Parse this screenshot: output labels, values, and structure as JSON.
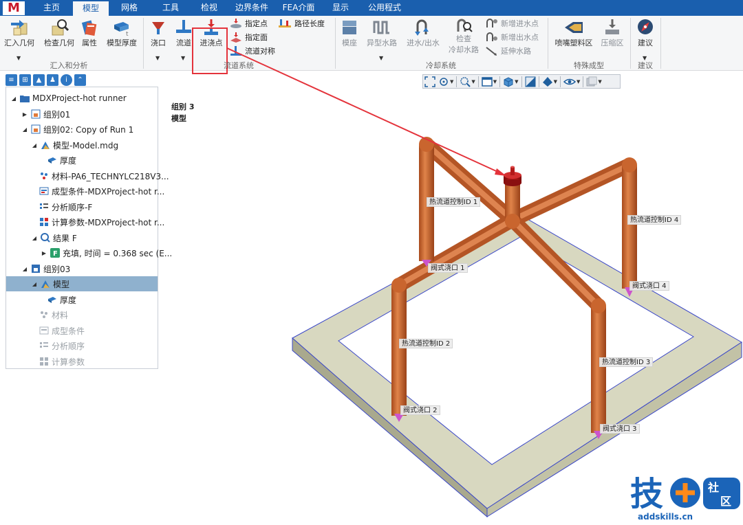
{
  "app": {
    "logo": "M"
  },
  "menu": {
    "tabs": [
      "主页",
      "模型",
      "网格",
      "工具",
      "检视",
      "边界条件",
      "FEA介面",
      "显示",
      "公用程式"
    ],
    "active": "模型"
  },
  "ribbon": {
    "import": {
      "import_geometry": "汇入几何",
      "check_geometry": "检查几何",
      "properties": "属性",
      "model_thickness": "模型厚度",
      "group_label": "汇入和分析"
    },
    "runner": {
      "gate": "浇口",
      "runner": "流道",
      "injection_point": "进浇点",
      "specify_point": "指定点",
      "specify_face": "指定面",
      "runner_symmetry": "流道对称",
      "path_length": "路径长度",
      "group_label": "流道系统"
    },
    "cooling": {
      "mold_base": "模座",
      "special_channel": "异型水路",
      "inlet_outlet": "进水/出水",
      "check_cooling_1": "检查",
      "check_cooling_2": "冷却水路",
      "add_inlet": "新增进水点",
      "add_outlet": "新增出水点",
      "extend_channel": "延伸水路",
      "group_label": "冷却系统"
    },
    "special": {
      "nozzle": "喷嘴塑料区",
      "compress": "压缩区",
      "group_label": "特殊成型"
    },
    "advice": {
      "advice": "建议",
      "group_label": "建议"
    }
  },
  "tree": {
    "project": "MDXProject-hot runner",
    "group01": "组别01",
    "group02": "组别02: Copy of Run 1",
    "model_mdg": "模型-Model.mdg",
    "thickness_1": "厚度",
    "material": "材料-PA6_TECHNYLC218V3...",
    "process": "成型条件-MDXProject-hot r...",
    "sequence": "分析顺序-F",
    "params": "计算参数-MDXProject-hot r...",
    "results": "结果  F",
    "filling": "充填, 时间 = 0.368 sec (E...",
    "group03": "组别03",
    "model": "模型",
    "thickness_2": "厚度",
    "material_2": "材料",
    "process_2": "成型条件",
    "sequence_2": "分析顺序",
    "params_2": "计算参数"
  },
  "viewport": {
    "title_line1": "组别 3",
    "title_line2": "模型",
    "labels": {
      "hr1": "热流道控制ID 1",
      "hr2": "热流道控制ID 2",
      "hr3": "热流道控制ID 3",
      "hr4": "热流道控制ID 4",
      "vg1": "阀式浇口 1",
      "vg2": "阀式浇口 2",
      "vg3": "阀式浇口 3",
      "vg4": "阀式浇口 4"
    }
  },
  "watermark": {
    "chars": "技",
    "badge_1": "社",
    "badge_2": "区",
    "url": "addskills.cn"
  },
  "colors": {
    "menu_bg": "#1a5fae",
    "highlight": "#e4333b",
    "runner": "#c9652e",
    "plate": "#d8d8c0"
  }
}
